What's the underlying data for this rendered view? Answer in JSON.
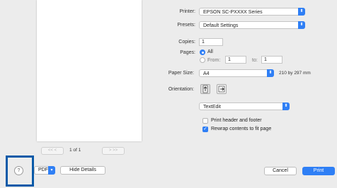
{
  "printer": {
    "label": "Printer:",
    "value": "EPSON SC-PXXXX Series"
  },
  "presets": {
    "label": "Presets:",
    "value": "Default Settings"
  },
  "copies": {
    "label": "Copies:",
    "value": "1"
  },
  "pages": {
    "label": "Pages:",
    "all_label": "All",
    "from_label": "From:",
    "from_value": "1",
    "to_label": "to:",
    "to_value": "1"
  },
  "paper_size": {
    "label": "Paper Size:",
    "value": "A4",
    "dimensions": "210 by 297 mm"
  },
  "orientation": {
    "label": "Orientation:"
  },
  "app_menu": {
    "value": "TextEdit"
  },
  "options": {
    "header_footer": "Print header and footer",
    "rewrap": "Rewrap contents to fit page"
  },
  "pager": {
    "prev_label": "<<  <",
    "page_label": "1 of 1",
    "next_label": ">  >>"
  },
  "footer": {
    "help": "?",
    "pdf_label": "PDF",
    "hide_details": "Hide Details",
    "cancel": "Cancel",
    "print": "Print"
  },
  "colors": {
    "accent": "#2f7ff5",
    "highlight": "#0a5aa8"
  }
}
